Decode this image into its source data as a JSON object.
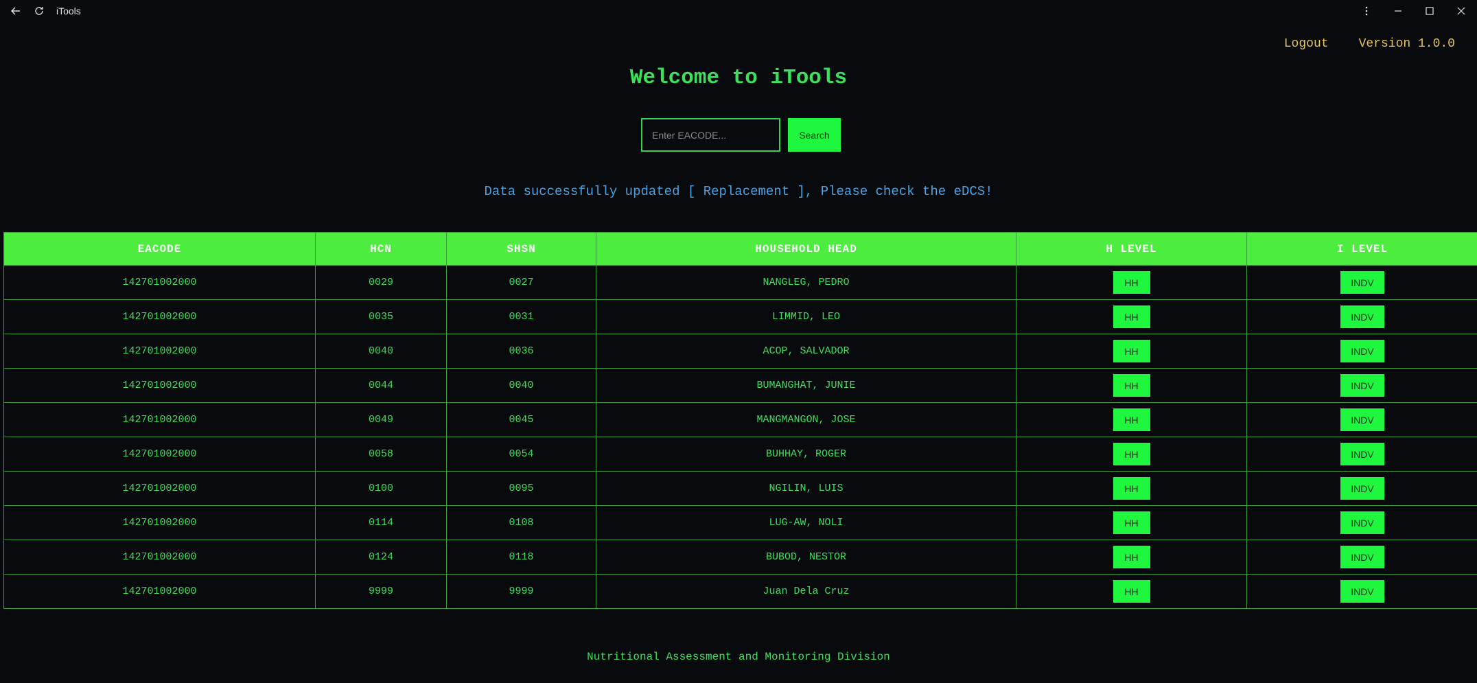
{
  "window": {
    "title": "iTools"
  },
  "nav": {
    "logout": "Logout",
    "version": "Version 1.0.0"
  },
  "welcome": "Welcome to iTools",
  "search": {
    "placeholder": "Enter EACODE...",
    "button": "Search"
  },
  "status_message": "Data successfully updated [ Replacement ], Please check the eDCS!",
  "table": {
    "columns": [
      "EACODE",
      "HCN",
      "SHSN",
      "HOUSEHOLD HEAD",
      "H LEVEL",
      "I LEVEL"
    ],
    "rows": [
      {
        "eacode": "142701002000",
        "hcn": "0029",
        "shsn": "0027",
        "head": "NANGLEG, PEDRO",
        "h": "HH",
        "i": "INDV"
      },
      {
        "eacode": "142701002000",
        "hcn": "0035",
        "shsn": "0031",
        "head": "LIMMID, LEO",
        "h": "HH",
        "i": "INDV"
      },
      {
        "eacode": "142701002000",
        "hcn": "0040",
        "shsn": "0036",
        "head": "ACOP, SALVADOR",
        "h": "HH",
        "i": "INDV"
      },
      {
        "eacode": "142701002000",
        "hcn": "0044",
        "shsn": "0040",
        "head": "BUMANGHAT, JUNIE",
        "h": "HH",
        "i": "INDV"
      },
      {
        "eacode": "142701002000",
        "hcn": "0049",
        "shsn": "0045",
        "head": "MANGMANGON, JOSE",
        "h": "HH",
        "i": "INDV"
      },
      {
        "eacode": "142701002000",
        "hcn": "0058",
        "shsn": "0054",
        "head": "BUHHAY, ROGER",
        "h": "HH",
        "i": "INDV"
      },
      {
        "eacode": "142701002000",
        "hcn": "0100",
        "shsn": "0095",
        "head": "NGILIN, LUIS",
        "h": "HH",
        "i": "INDV"
      },
      {
        "eacode": "142701002000",
        "hcn": "0114",
        "shsn": "0108",
        "head": "LUG-AW, NOLI",
        "h": "HH",
        "i": "INDV"
      },
      {
        "eacode": "142701002000",
        "hcn": "0124",
        "shsn": "0118",
        "head": "BUBOD, NESTOR",
        "h": "HH",
        "i": "INDV"
      },
      {
        "eacode": "142701002000",
        "hcn": "9999",
        "shsn": "9999",
        "head": "Juan Dela Cruz",
        "h": "HH",
        "i": "INDV"
      }
    ]
  },
  "footer": "Nutritional Assessment and Monitoring Division",
  "icons": [
    "back-arrow-icon",
    "refresh-icon",
    "more-vertical-icon",
    "minimize-icon",
    "maximize-icon",
    "close-icon"
  ],
  "colors": {
    "background": "#080a0d",
    "accent_green": "#1ff73f",
    "header_green": "#4ced3e",
    "text_green": "#3de05a",
    "nav_gold": "#e6c65a",
    "status_blue": "#4aa3e0"
  }
}
